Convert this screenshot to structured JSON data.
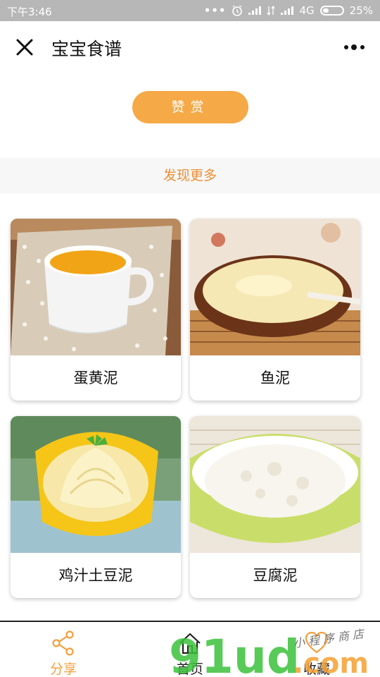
{
  "status_bar": {
    "time": "下午3:46",
    "dots": "•••",
    "network": "4G",
    "battery": "25%"
  },
  "nav": {
    "title": "宝宝食谱",
    "close_icon": "close-icon",
    "more_icon": "more-dots-icon"
  },
  "reward": {
    "label": "赞赏"
  },
  "discover": {
    "label": "发现更多"
  },
  "recipes": [
    {
      "name": "蛋黄泥"
    },
    {
      "name": "鱼泥"
    },
    {
      "name": "鸡汁土豆泥"
    },
    {
      "name": "豆腐泥"
    }
  ],
  "tabs": [
    {
      "label": "分享",
      "icon": "share-icon"
    },
    {
      "label": "首页",
      "icon": "home-icon"
    },
    {
      "label": "收藏",
      "icon": "heart-icon"
    }
  ],
  "watermark": {
    "logo": "91ud.com",
    "handwriting": "小程序商店"
  },
  "colors": {
    "accent": "#f5a947",
    "discover_text": "#ee8d34",
    "status_bar": "#b7b7b7",
    "active_tab": "#f39f3f"
  }
}
